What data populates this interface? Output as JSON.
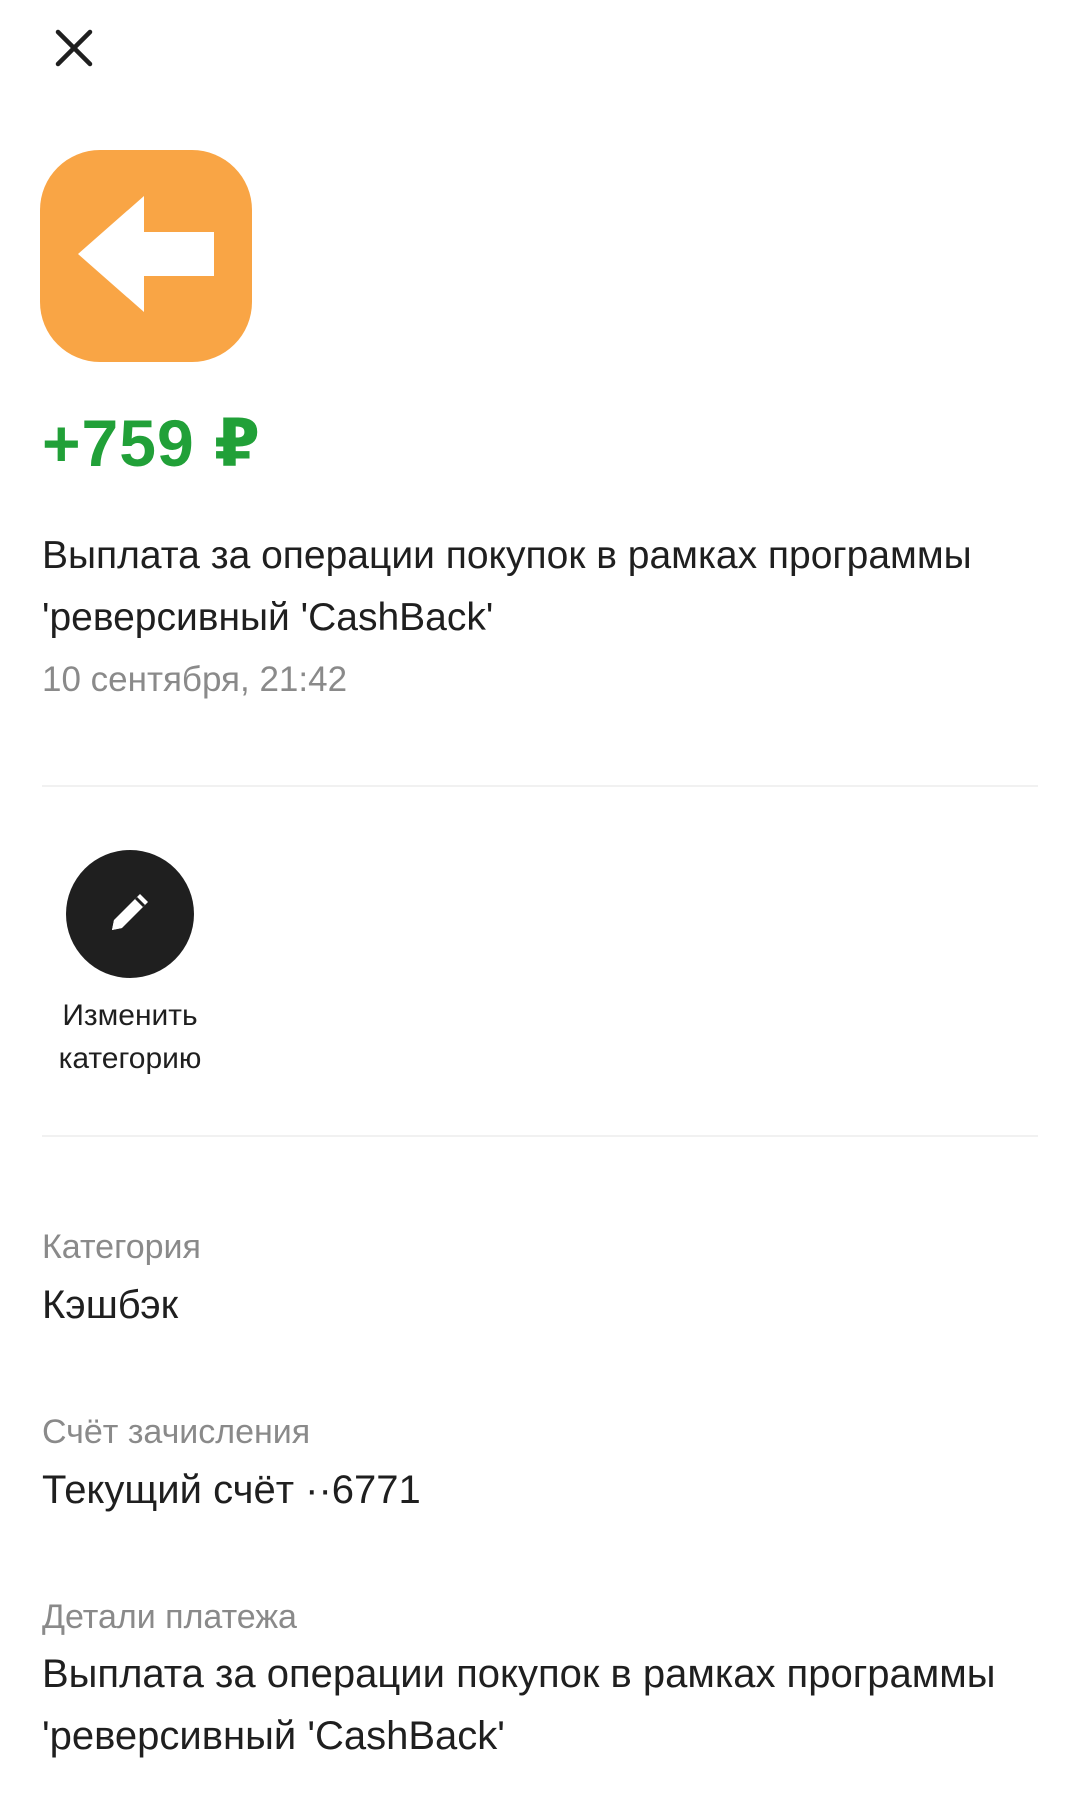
{
  "header": {
    "close_icon": "close-icon"
  },
  "transaction": {
    "icon": "arrow-left-icon",
    "icon_color": "#f9a545",
    "amount": "+759 ₽",
    "amount_color": "#21a038",
    "title": "Выплата за операции покупок в рамках программы 'реверсивный 'CashBack'",
    "date": "10 сентября, 21:42"
  },
  "actions": [
    {
      "icon": "pencil-icon",
      "label": "Изменить\nкатегорию"
    }
  ],
  "details": {
    "category_label": "Категория",
    "category_value": "Кэшбэк",
    "account_label": "Счёт зачисления",
    "account_value": "Текущий счёт ··6771",
    "payment_details_label": "Детали платежа",
    "payment_details_value": "Выплата за операции покупок в рамках программы 'реверсивный 'CashBack'"
  }
}
